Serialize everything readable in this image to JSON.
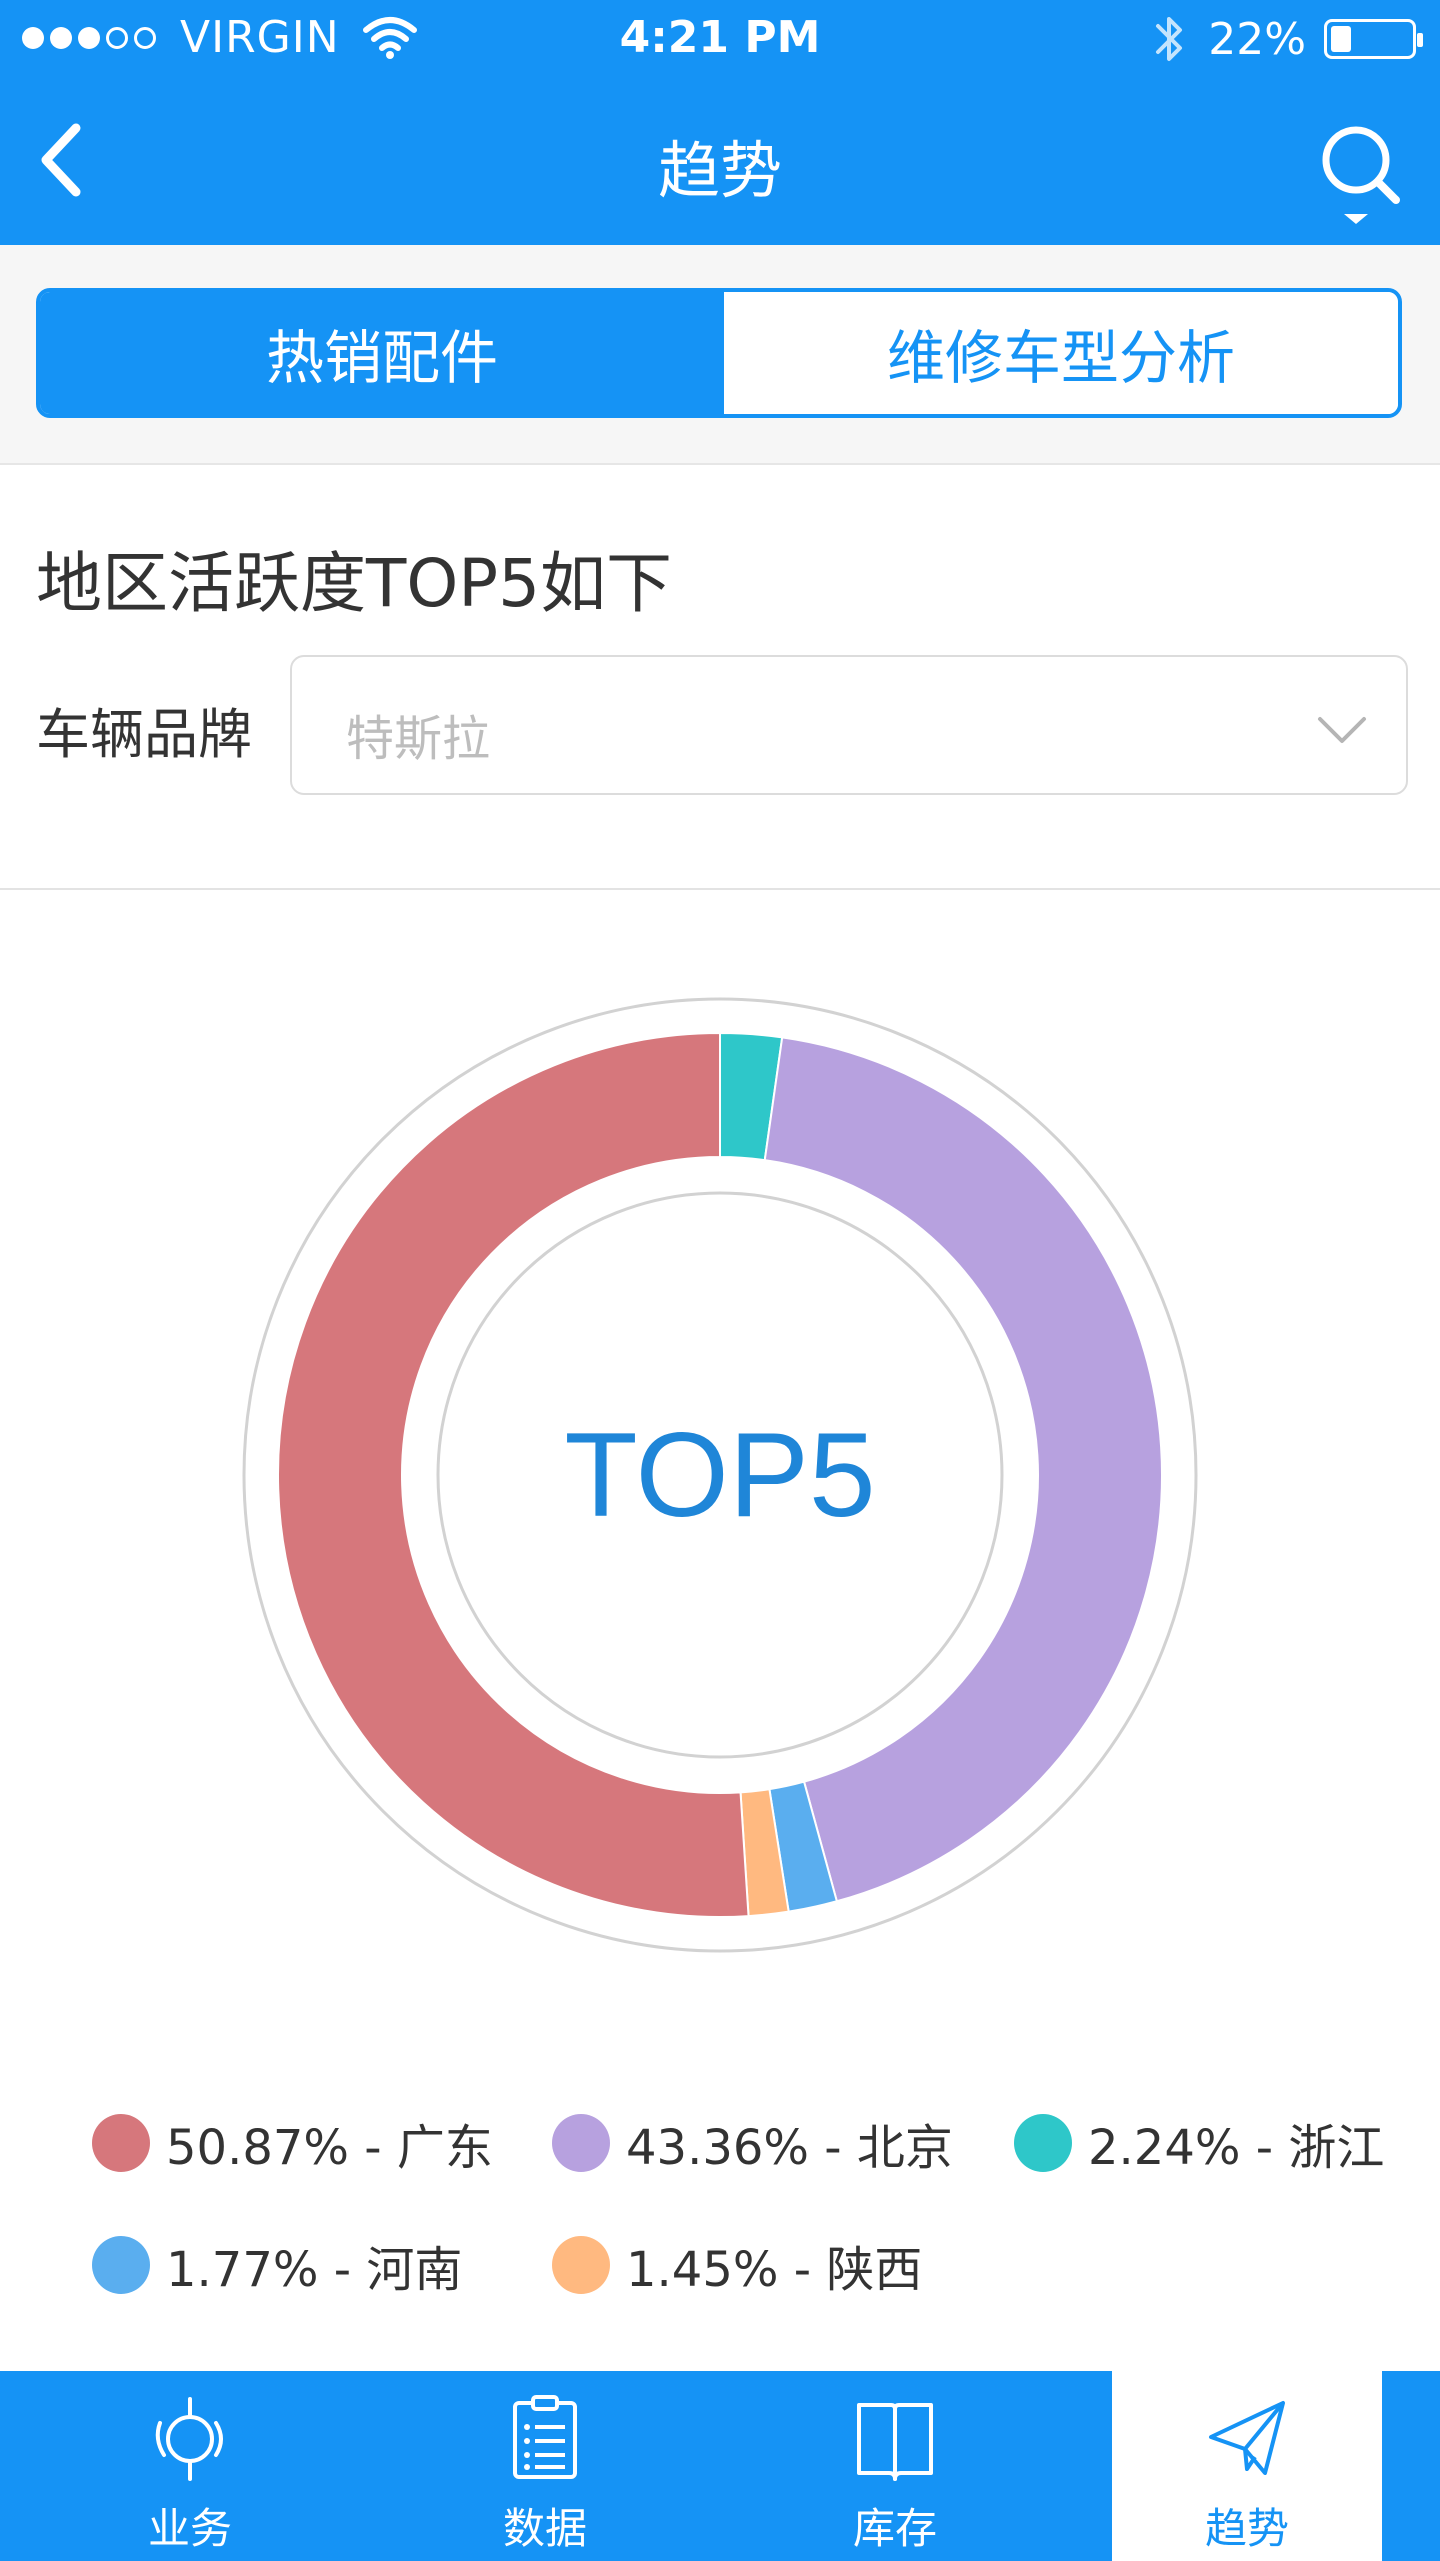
{
  "status_bar": {
    "carrier": "VIRGIN",
    "time": "4:21 PM",
    "battery": "22%",
    "battery_level": 0.22,
    "signal_bars": 3
  },
  "nav": {
    "title": "趋势",
    "back_icon": "chevron-left-icon",
    "search_icon": "search-icon"
  },
  "tabs": [
    {
      "label": "热销配件",
      "active": true
    },
    {
      "label": "维修车型分析",
      "active": false
    }
  ],
  "section": {
    "title": "地区活跃度TOP5如下",
    "filter_label": "车辆品牌",
    "filter_placeholder": "特斯拉"
  },
  "chart_data": {
    "type": "pie",
    "center_label": "TOP5",
    "slices": [
      {
        "label": "50.87% - 广东",
        "value": 50.87,
        "color": "#d6777c"
      },
      {
        "label": "43.36% - 北京",
        "value": 43.36,
        "color": "#b7a1df"
      },
      {
        "label": "2.24% - 浙江",
        "value": 2.24,
        "color": "#2ec7c9"
      },
      {
        "label": "1.77% - 河南",
        "value": 1.77,
        "color": "#5aaeef"
      },
      {
        "label": "1.45% - 陕西",
        "value": 1.45,
        "color": "#ffb980"
      }
    ],
    "legend_placement": "bottom"
  },
  "tabbar": [
    {
      "label": "业务",
      "icon": "business-icon",
      "active": false
    },
    {
      "label": "数据",
      "icon": "clipboard-list-icon",
      "active": false
    },
    {
      "label": "库存",
      "icon": "book-icon",
      "active": false
    },
    {
      "label": "趋势",
      "icon": "paper-plane-icon",
      "active": true
    }
  ],
  "colors": {
    "accent": "#1593f5",
    "text": "#333333",
    "placeholder": "#bdbdbd"
  }
}
